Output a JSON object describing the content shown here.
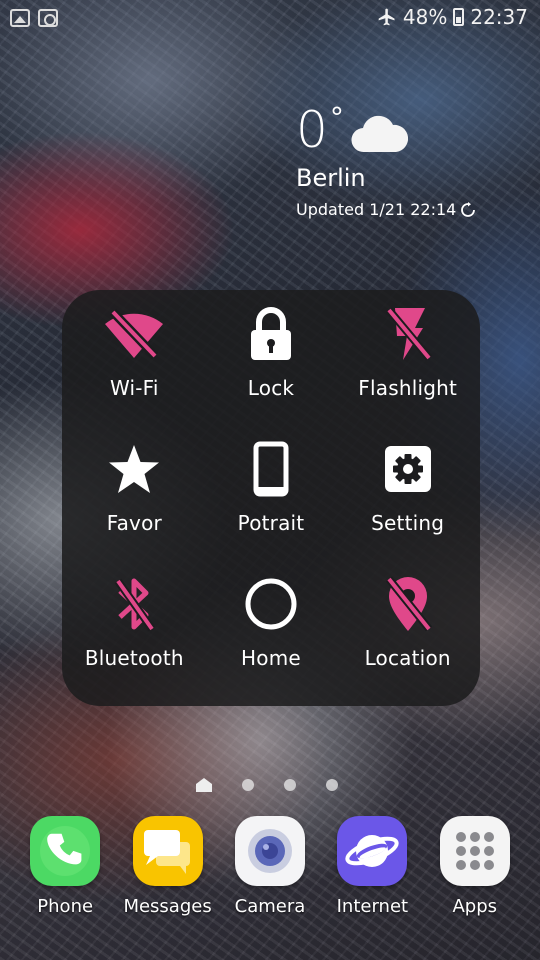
{
  "status_bar": {
    "battery": "48%",
    "time": "22:37",
    "left_icons": [
      "gallery-notification-icon",
      "settings-notification-icon"
    ],
    "right_icons": [
      "airplane-mode-icon",
      "battery-icon"
    ]
  },
  "weather": {
    "temperature": "0",
    "degree": "°",
    "city": "Berlin",
    "updated": "Updated 1/21 22:14",
    "icons": [
      "cloud-icon",
      "refresh-icon"
    ]
  },
  "quick_panel": {
    "active_color": "#e0488a",
    "tiles": [
      {
        "label": "Wi-Fi",
        "icon": "wifi-off-icon",
        "state": "off"
      },
      {
        "label": "Lock",
        "icon": "lock-icon",
        "state": "on"
      },
      {
        "label": "Flashlight",
        "icon": "flashlight-off-icon",
        "state": "off"
      },
      {
        "label": "Favor",
        "icon": "star-icon",
        "state": "on"
      },
      {
        "label": "Potrait",
        "icon": "portrait-icon",
        "state": "on"
      },
      {
        "label": "Setting",
        "icon": "gear-icon",
        "state": "on"
      },
      {
        "label": "Bluetooth",
        "icon": "bluetooth-off-icon",
        "state": "off"
      },
      {
        "label": "Home",
        "icon": "home-circle-icon",
        "state": "on"
      },
      {
        "label": "Location",
        "icon": "location-off-icon",
        "state": "off"
      }
    ]
  },
  "pager": {
    "pages": 4,
    "current": 0
  },
  "dock": {
    "apps": [
      {
        "label": "Phone",
        "icon": "phone-icon",
        "color": "#4cd964"
      },
      {
        "label": "Messages",
        "icon": "messages-icon",
        "color": "#f9c400"
      },
      {
        "label": "Camera",
        "icon": "camera-icon",
        "color": "#f4f4f6"
      },
      {
        "label": "Internet",
        "icon": "internet-icon",
        "color": "#6b57e8"
      },
      {
        "label": "Apps",
        "icon": "apps-grid-icon",
        "color": "#f4f4f4"
      }
    ]
  }
}
